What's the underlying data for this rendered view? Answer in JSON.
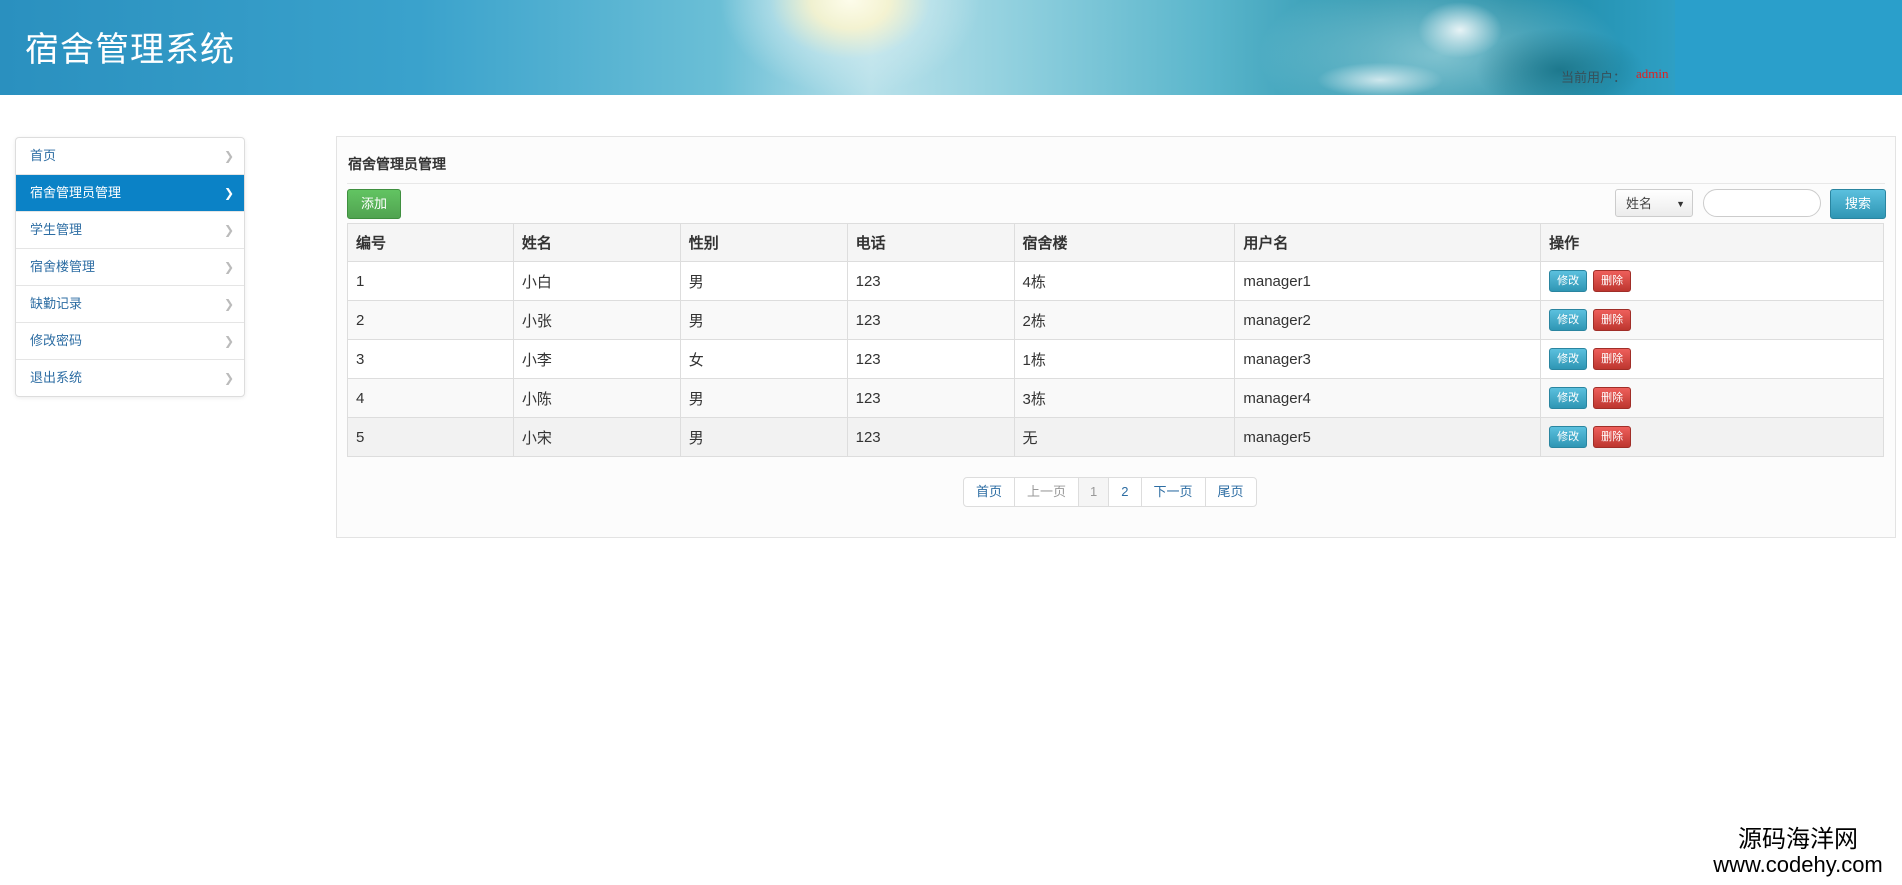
{
  "header": {
    "title": "宿舍管理系统",
    "user_label": "当前用户：",
    "user_name": "admin"
  },
  "sidebar": {
    "items": [
      {
        "label": "首页",
        "active": false
      },
      {
        "label": "宿舍管理员管理",
        "active": true
      },
      {
        "label": "学生管理",
        "active": false
      },
      {
        "label": "宿舍楼管理",
        "active": false
      },
      {
        "label": "缺勤记录",
        "active": false
      },
      {
        "label": "修改密码",
        "active": false
      },
      {
        "label": "退出系统",
        "active": false
      }
    ]
  },
  "main": {
    "title": "宿舍管理员管理",
    "add_label": "添加",
    "search_field_selected": "姓名",
    "search_value": "",
    "search_label": "搜索",
    "columns": [
      "编号",
      "姓名",
      "性别",
      "电话",
      "宿舍楼",
      "用户名",
      "操作"
    ],
    "rows": [
      [
        "1",
        "小白",
        "男",
        "123",
        "4栋",
        "manager1"
      ],
      [
        "2",
        "小张",
        "男",
        "123",
        "2栋",
        "manager2"
      ],
      [
        "3",
        "小李",
        "女",
        "123",
        "1栋",
        "manager3"
      ],
      [
        "4",
        "小陈",
        "男",
        "123",
        "3栋",
        "manager4"
      ],
      [
        "5",
        "小宋",
        "男",
        "123",
        "无",
        "manager5"
      ]
    ],
    "row_actions": {
      "edit": "修改",
      "delete": "删除"
    },
    "pagination": {
      "first": "首页",
      "prev": "上一页",
      "pages": [
        "1",
        "2"
      ],
      "current_page": "1",
      "next": "下一页",
      "last": "尾页"
    }
  },
  "watermark": {
    "cn": "源码海洋网",
    "en": "www.codehy.com"
  },
  "colors": {
    "accent": "#0b82c6",
    "success": "#51a351",
    "info": "#2f96b4",
    "danger": "#bd362f",
    "user_name": "#e02020"
  }
}
